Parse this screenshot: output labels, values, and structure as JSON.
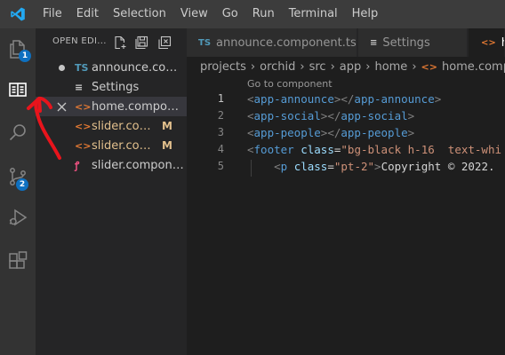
{
  "menubar": {
    "items": [
      "File",
      "Edit",
      "Selection",
      "View",
      "Go",
      "Run",
      "Terminal",
      "Help"
    ],
    "accent": "#23a9f2"
  },
  "activitybar": {
    "items": [
      {
        "name": "explorer",
        "icon": "files-icon",
        "badge": "1"
      },
      {
        "name": "book",
        "icon": "book-icon",
        "badge": ""
      },
      {
        "name": "search",
        "icon": "search-icon",
        "badge": ""
      },
      {
        "name": "source-control",
        "icon": "source-control-icon",
        "badge": "2"
      },
      {
        "name": "run-debug",
        "icon": "run-debug-icon",
        "badge": ""
      },
      {
        "name": "extensions",
        "icon": "extensions-icon",
        "badge": ""
      }
    ],
    "badge_color": "#0e70c0"
  },
  "sidebar": {
    "open_editors_title": "OPEN EDI...",
    "open_editors": [
      {
        "lead": "dot",
        "icon": "TS",
        "icon_color": "#519aba",
        "name": "announce.comp...",
        "flag": "",
        "modified": false,
        "selected": false
      },
      {
        "lead": "",
        "icon": "≡",
        "icon_color": "#cccccc",
        "name": "Settings",
        "flag": "",
        "modified": false,
        "selected": false
      },
      {
        "lead": "close",
        "icon": "<>",
        "icon_color": "#e37933",
        "name": "home.compone...",
        "flag": "",
        "modified": false,
        "selected": true
      },
      {
        "lead": "",
        "icon": "<>",
        "icon_color": "#e37933",
        "name": "slider.com...",
        "flag": "M",
        "modified": true,
        "selected": false
      },
      {
        "lead": "",
        "icon": "<>",
        "icon_color": "#e37933",
        "name": "slider.com...",
        "flag": "M",
        "modified": true,
        "selected": false
      },
      {
        "lead": "",
        "icon": "ꝭ",
        "icon_color": "#f55385",
        "name": "slider.componen...",
        "flag": "",
        "modified": false,
        "selected": false
      }
    ]
  },
  "tabs": [
    {
      "icon": "TS",
      "icon_color": "#519aba",
      "label": "announce.component.ts",
      "dirty": true,
      "active": false
    },
    {
      "icon": "≡",
      "icon_color": "#cccccc",
      "label": "Settings",
      "dirty": false,
      "active": false
    },
    {
      "icon": "<>",
      "icon_color": "#e37933",
      "label": "ho",
      "dirty": false,
      "active": true
    }
  ],
  "breadcrumb": {
    "parts": [
      "projects",
      "orchid",
      "src",
      "app",
      "home"
    ],
    "file": "home.compone"
  },
  "editor": {
    "codelens": "Go to component",
    "lines": [
      {
        "num": "1",
        "current": true
      },
      {
        "num": "2",
        "current": false
      },
      {
        "num": "3",
        "current": false
      },
      {
        "num": "4",
        "current": false
      },
      {
        "num": "5",
        "current": false
      }
    ],
    "code": {
      "l1": {
        "open": "app-announce",
        "close": "app-announce"
      },
      "l2": {
        "open": "app-social",
        "close": "app-social"
      },
      "l3": {
        "open": "app-people",
        "close": "app-people"
      },
      "l4": {
        "tag": "footer",
        "attr": "class",
        "value": "\"bg-black h-16  text-whi"
      },
      "l5": {
        "indent": "    ",
        "tag": "p",
        "attr": "class",
        "value": "\"pt-2\"",
        "text": "Copyright © 2022."
      }
    }
  },
  "annotation_color": "#e8141c"
}
